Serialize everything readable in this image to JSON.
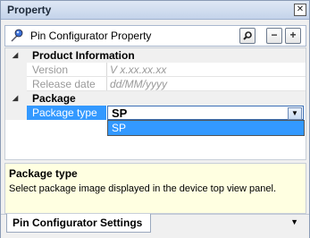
{
  "panel": {
    "title": "Property"
  },
  "toolbar": {
    "label": "Pin Configurator Property",
    "minus_label": "−",
    "plus_label": "+"
  },
  "grid": {
    "categories": [
      {
        "label": "Product Information",
        "rows": [
          {
            "name": "Version",
            "value": "V x.xx.xx.xx"
          },
          {
            "name": "Release date",
            "value": "dd/MM/yyyy"
          }
        ]
      },
      {
        "label": "Package",
        "rows": [
          {
            "name": "Package type",
            "value": "SP"
          }
        ]
      }
    ],
    "dropdown_options": [
      "SP"
    ]
  },
  "description": {
    "title": "Package type",
    "text": "Select package image displayed in the device top view panel."
  },
  "tabs": [
    {
      "label": "Pin Configurator Settings"
    }
  ],
  "colors": {
    "selection": "#3399ff",
    "description_bg": "#ffffe1",
    "title_bg": "#c4d3ea"
  },
  "icons": [
    "pin-icon",
    "search-icon",
    "close-icon",
    "expand-arrow-icon",
    "chevron-down-icon"
  ]
}
